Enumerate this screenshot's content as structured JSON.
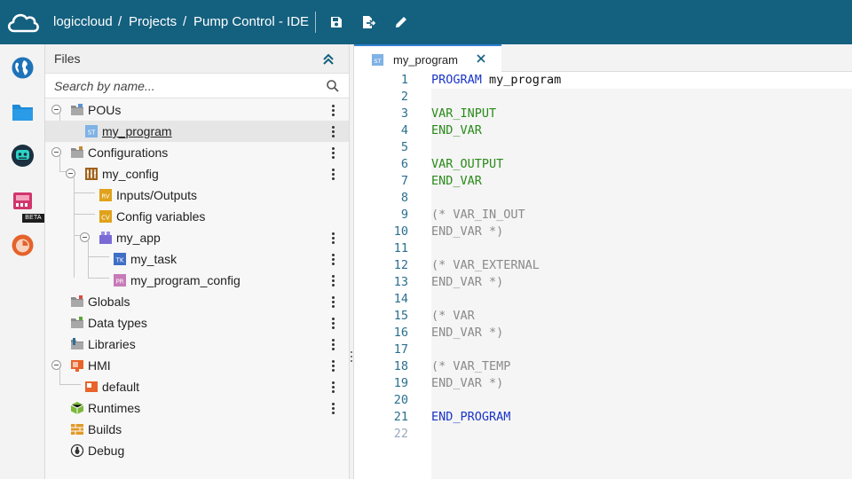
{
  "topbar": {
    "breadcrumb": [
      "logiccloud",
      "Projects",
      "Pump Control - IDE"
    ],
    "separator": "/",
    "actions": [
      "save-icon",
      "export-icon",
      "edit-icon"
    ],
    "background": "#14607f"
  },
  "activity_bar": {
    "items": [
      "globe-icon",
      "folder-icon",
      "robot-icon",
      "device-icon",
      "monitor-gauge-icon"
    ],
    "beta_badge": "BETA"
  },
  "files": {
    "title": "Files",
    "search_placeholder": "Search by name...",
    "tree": [
      {
        "label": "POUs",
        "icon": "folder-icon",
        "level": 0,
        "expanded": true
      },
      {
        "label": "my_program",
        "icon": "st-file-icon",
        "level": 1,
        "selected": true,
        "badge": "ST"
      },
      {
        "label": "Configurations",
        "icon": "folder-icon",
        "level": 0,
        "expanded": true
      },
      {
        "label": "my_config",
        "icon": "config-icon",
        "level": 1,
        "expanded": true
      },
      {
        "label": "Inputs/Outputs",
        "icon": "rv-icon",
        "level": 2,
        "badge": "RV"
      },
      {
        "label": "Config variables",
        "icon": "cv-icon",
        "level": 2,
        "badge": "CV"
      },
      {
        "label": "my_app",
        "icon": "app-icon",
        "level": 2,
        "expanded": true
      },
      {
        "label": "my_task",
        "icon": "task-icon",
        "level": 3,
        "badge": "TK"
      },
      {
        "label": "my_program_config",
        "icon": "pr-icon",
        "level": 3,
        "badge": "PR"
      },
      {
        "label": "Globals",
        "icon": "folder-icon",
        "level": 0
      },
      {
        "label": "Data types",
        "icon": "folder-icon",
        "level": 0
      },
      {
        "label": "Libraries",
        "icon": "library-icon",
        "level": 0
      },
      {
        "label": "HMI",
        "icon": "hmi-icon",
        "level": 0,
        "expanded": true
      },
      {
        "label": "default",
        "icon": "hmi-screen-icon",
        "level": 1
      },
      {
        "label": "Runtimes",
        "icon": "cube-icon",
        "level": 0
      },
      {
        "label": "Builds",
        "icon": "bricks-icon",
        "level": 0
      },
      {
        "label": "Debug",
        "icon": "bug-icon",
        "level": 0
      }
    ]
  },
  "editor": {
    "tab": {
      "label": "my_program",
      "icon_badge": "ST"
    },
    "lines": [
      {
        "n": "1",
        "parts": [
          [
            "PROGRAM",
            "kw-blue"
          ],
          [
            " my_program",
            "plain"
          ]
        ],
        "current": true
      },
      {
        "n": "2",
        "parts": []
      },
      {
        "n": "3",
        "parts": [
          [
            "VAR_INPUT",
            "kw-green"
          ]
        ]
      },
      {
        "n": "4",
        "parts": [
          [
            "END_VAR",
            "kw-green"
          ]
        ]
      },
      {
        "n": "5",
        "parts": []
      },
      {
        "n": "6",
        "parts": [
          [
            "VAR_OUTPUT",
            "kw-green"
          ]
        ]
      },
      {
        "n": "7",
        "parts": [
          [
            "END_VAR",
            "kw-green"
          ]
        ]
      },
      {
        "n": "8",
        "parts": []
      },
      {
        "n": "9",
        "parts": [
          [
            "(* VAR_IN_OUT",
            "cmt"
          ]
        ]
      },
      {
        "n": "10",
        "parts": [
          [
            "END_VAR *)",
            "cmt"
          ]
        ]
      },
      {
        "n": "11",
        "parts": []
      },
      {
        "n": "12",
        "parts": [
          [
            "(* VAR_EXTERNAL",
            "cmt"
          ]
        ]
      },
      {
        "n": "13",
        "parts": [
          [
            "END_VAR *)",
            "cmt"
          ]
        ]
      },
      {
        "n": "14",
        "parts": []
      },
      {
        "n": "15",
        "parts": [
          [
            "(* VAR",
            "cmt"
          ]
        ]
      },
      {
        "n": "16",
        "parts": [
          [
            "END_VAR *)",
            "cmt"
          ]
        ]
      },
      {
        "n": "17",
        "parts": []
      },
      {
        "n": "18",
        "parts": [
          [
            "(* VAR_TEMP",
            "cmt"
          ]
        ]
      },
      {
        "n": "19",
        "parts": [
          [
            "END_VAR *)",
            "cmt"
          ]
        ]
      },
      {
        "n": "20",
        "parts": []
      },
      {
        "n": "21",
        "parts": [
          [
            "END_PROGRAM",
            "kw-blue"
          ]
        ]
      },
      {
        "n": "22",
        "parts": [],
        "dim": true
      }
    ]
  }
}
